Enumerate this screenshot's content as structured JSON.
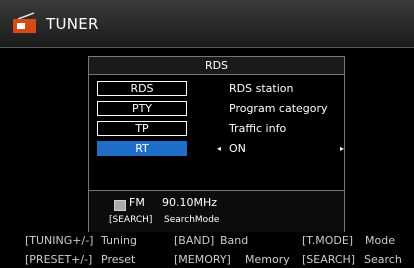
{
  "header": {
    "title": "TUNER",
    "icon": "radio-icon"
  },
  "dialog": {
    "title": "RDS",
    "options": [
      {
        "label": "RDS",
        "description": "RDS station"
      },
      {
        "label": "PTY",
        "description": "Program category"
      },
      {
        "label": "TP",
        "description": "Traffic info"
      },
      {
        "label": "RT",
        "selected": true
      }
    ],
    "selected_value": "ON",
    "left_arrow": "◂",
    "right_arrow": "▸",
    "status": {
      "band": "FM",
      "frequency": "90.10MHz"
    },
    "search": {
      "key": "[SEARCH]",
      "label": "SearchMode"
    }
  },
  "guide": {
    "row1": {
      "tuning_key": "[TUNING+/-]",
      "tuning_label": "Tuning",
      "band_key": "[BAND]",
      "band_label": "Band",
      "tmode_key": "[T.MODE]",
      "tmode_label": "Mode"
    },
    "row2": {
      "preset_key": "[PRESET+/-]",
      "preset_label": "Preset",
      "memory_key": "[MEMORY]",
      "memory_label": "Memory",
      "search_key": "[SEARCH]",
      "search_label": "Search"
    }
  },
  "colors": {
    "selection": "#1f6fc8",
    "background": "#000000"
  }
}
